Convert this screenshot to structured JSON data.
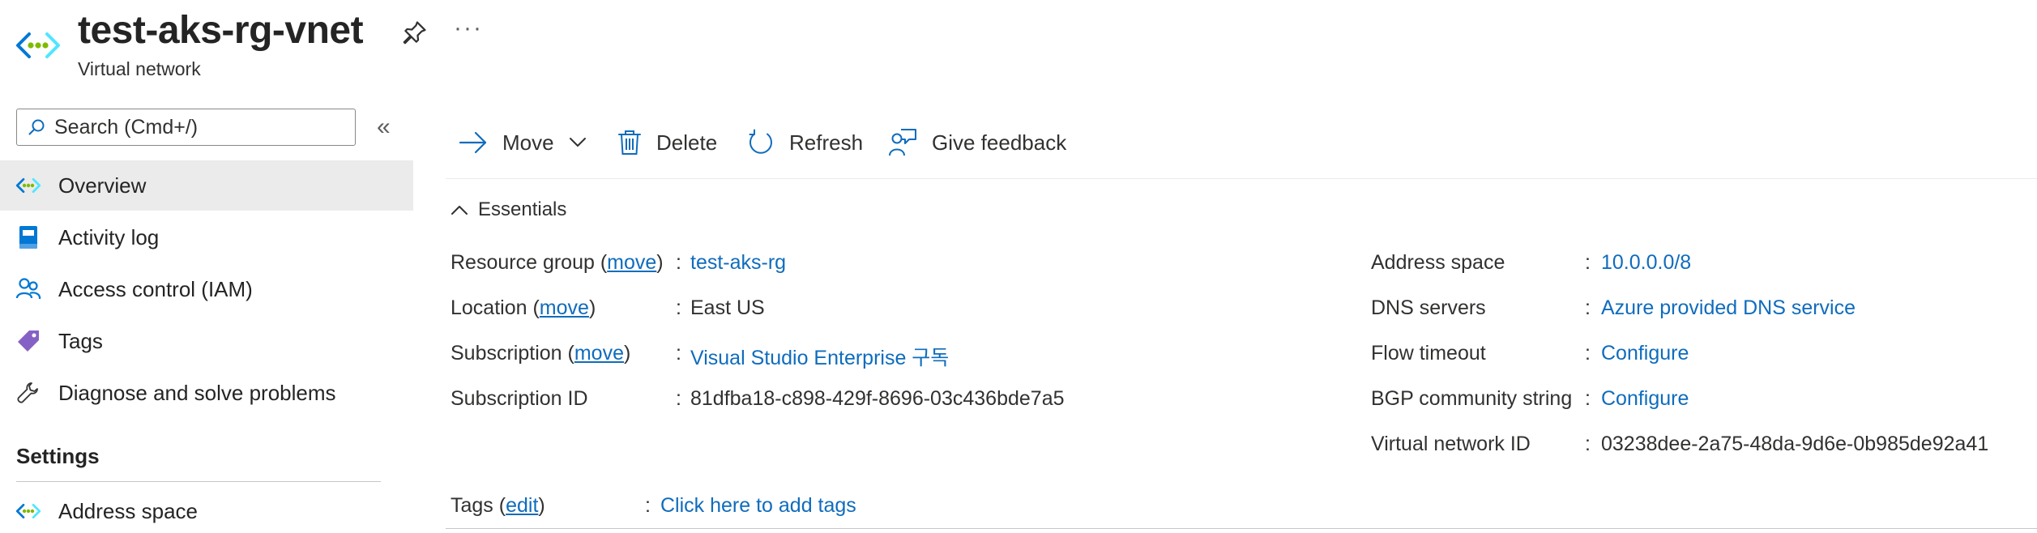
{
  "header": {
    "title": "test-aks-rg-vnet",
    "subtitle": "Virtual network",
    "more_label": "···"
  },
  "sidebar": {
    "search_placeholder": "Search (Cmd+/)",
    "collapse_label": "«",
    "items": [
      {
        "label": "Overview",
        "icon": "vnet-icon",
        "active": true
      },
      {
        "label": "Activity log",
        "icon": "activity-log-icon"
      },
      {
        "label": "Access control (IAM)",
        "icon": "people-icon"
      },
      {
        "label": "Tags",
        "icon": "tag-icon"
      },
      {
        "label": "Diagnose and solve problems",
        "icon": "wrench-icon"
      }
    ],
    "settings_title": "Settings",
    "settings_items": [
      {
        "label": "Address space",
        "icon": "vnet-icon"
      }
    ]
  },
  "toolbar": {
    "move_label": "Move",
    "delete_label": "Delete",
    "refresh_label": "Refresh",
    "feedback_label": "Give feedback"
  },
  "essentials": {
    "title": "Essentials",
    "left": [
      {
        "label_pre": "Resource group (",
        "link": "move",
        "label_post": ")",
        "value": "test-aks-rg",
        "value_is_link": true
      },
      {
        "label_pre": "Location (",
        "link": "move",
        "label_post": ")",
        "value": "East US",
        "value_is_link": false
      },
      {
        "label_pre": "Subscription (",
        "link": "move",
        "label_post": ")",
        "value": "Visual Studio Enterprise 구독",
        "value_is_link": true
      },
      {
        "label_pre": "Subscription ID",
        "link": "",
        "label_post": "",
        "value": "81dfba18-c898-429f-8696-03c436bde7a5",
        "value_is_link": false
      }
    ],
    "right": [
      {
        "label": "Address space",
        "value": "10.0.0.0/8",
        "value_is_link": true
      },
      {
        "label": "DNS servers",
        "value": "Azure provided DNS service",
        "value_is_link": true
      },
      {
        "label": "Flow timeout",
        "value": "Configure",
        "value_is_link": true
      },
      {
        "label": "BGP community string",
        "value": "Configure",
        "value_is_link": true
      },
      {
        "label": "Virtual network ID",
        "value": "03238dee-2a75-48da-9d6e-0b985de92a41",
        "value_is_link": false
      }
    ],
    "tags": {
      "label_pre": "Tags (",
      "link": "edit",
      "label_post": ")",
      "value": "Click here to add tags"
    },
    "colon": ":"
  },
  "colors": {
    "link": "#0f6cbd",
    "active_bg": "#ebebeb",
    "icon_blue": "#0078d4",
    "icon_green": "#7fba00",
    "tag_purple": "#8661c5"
  }
}
